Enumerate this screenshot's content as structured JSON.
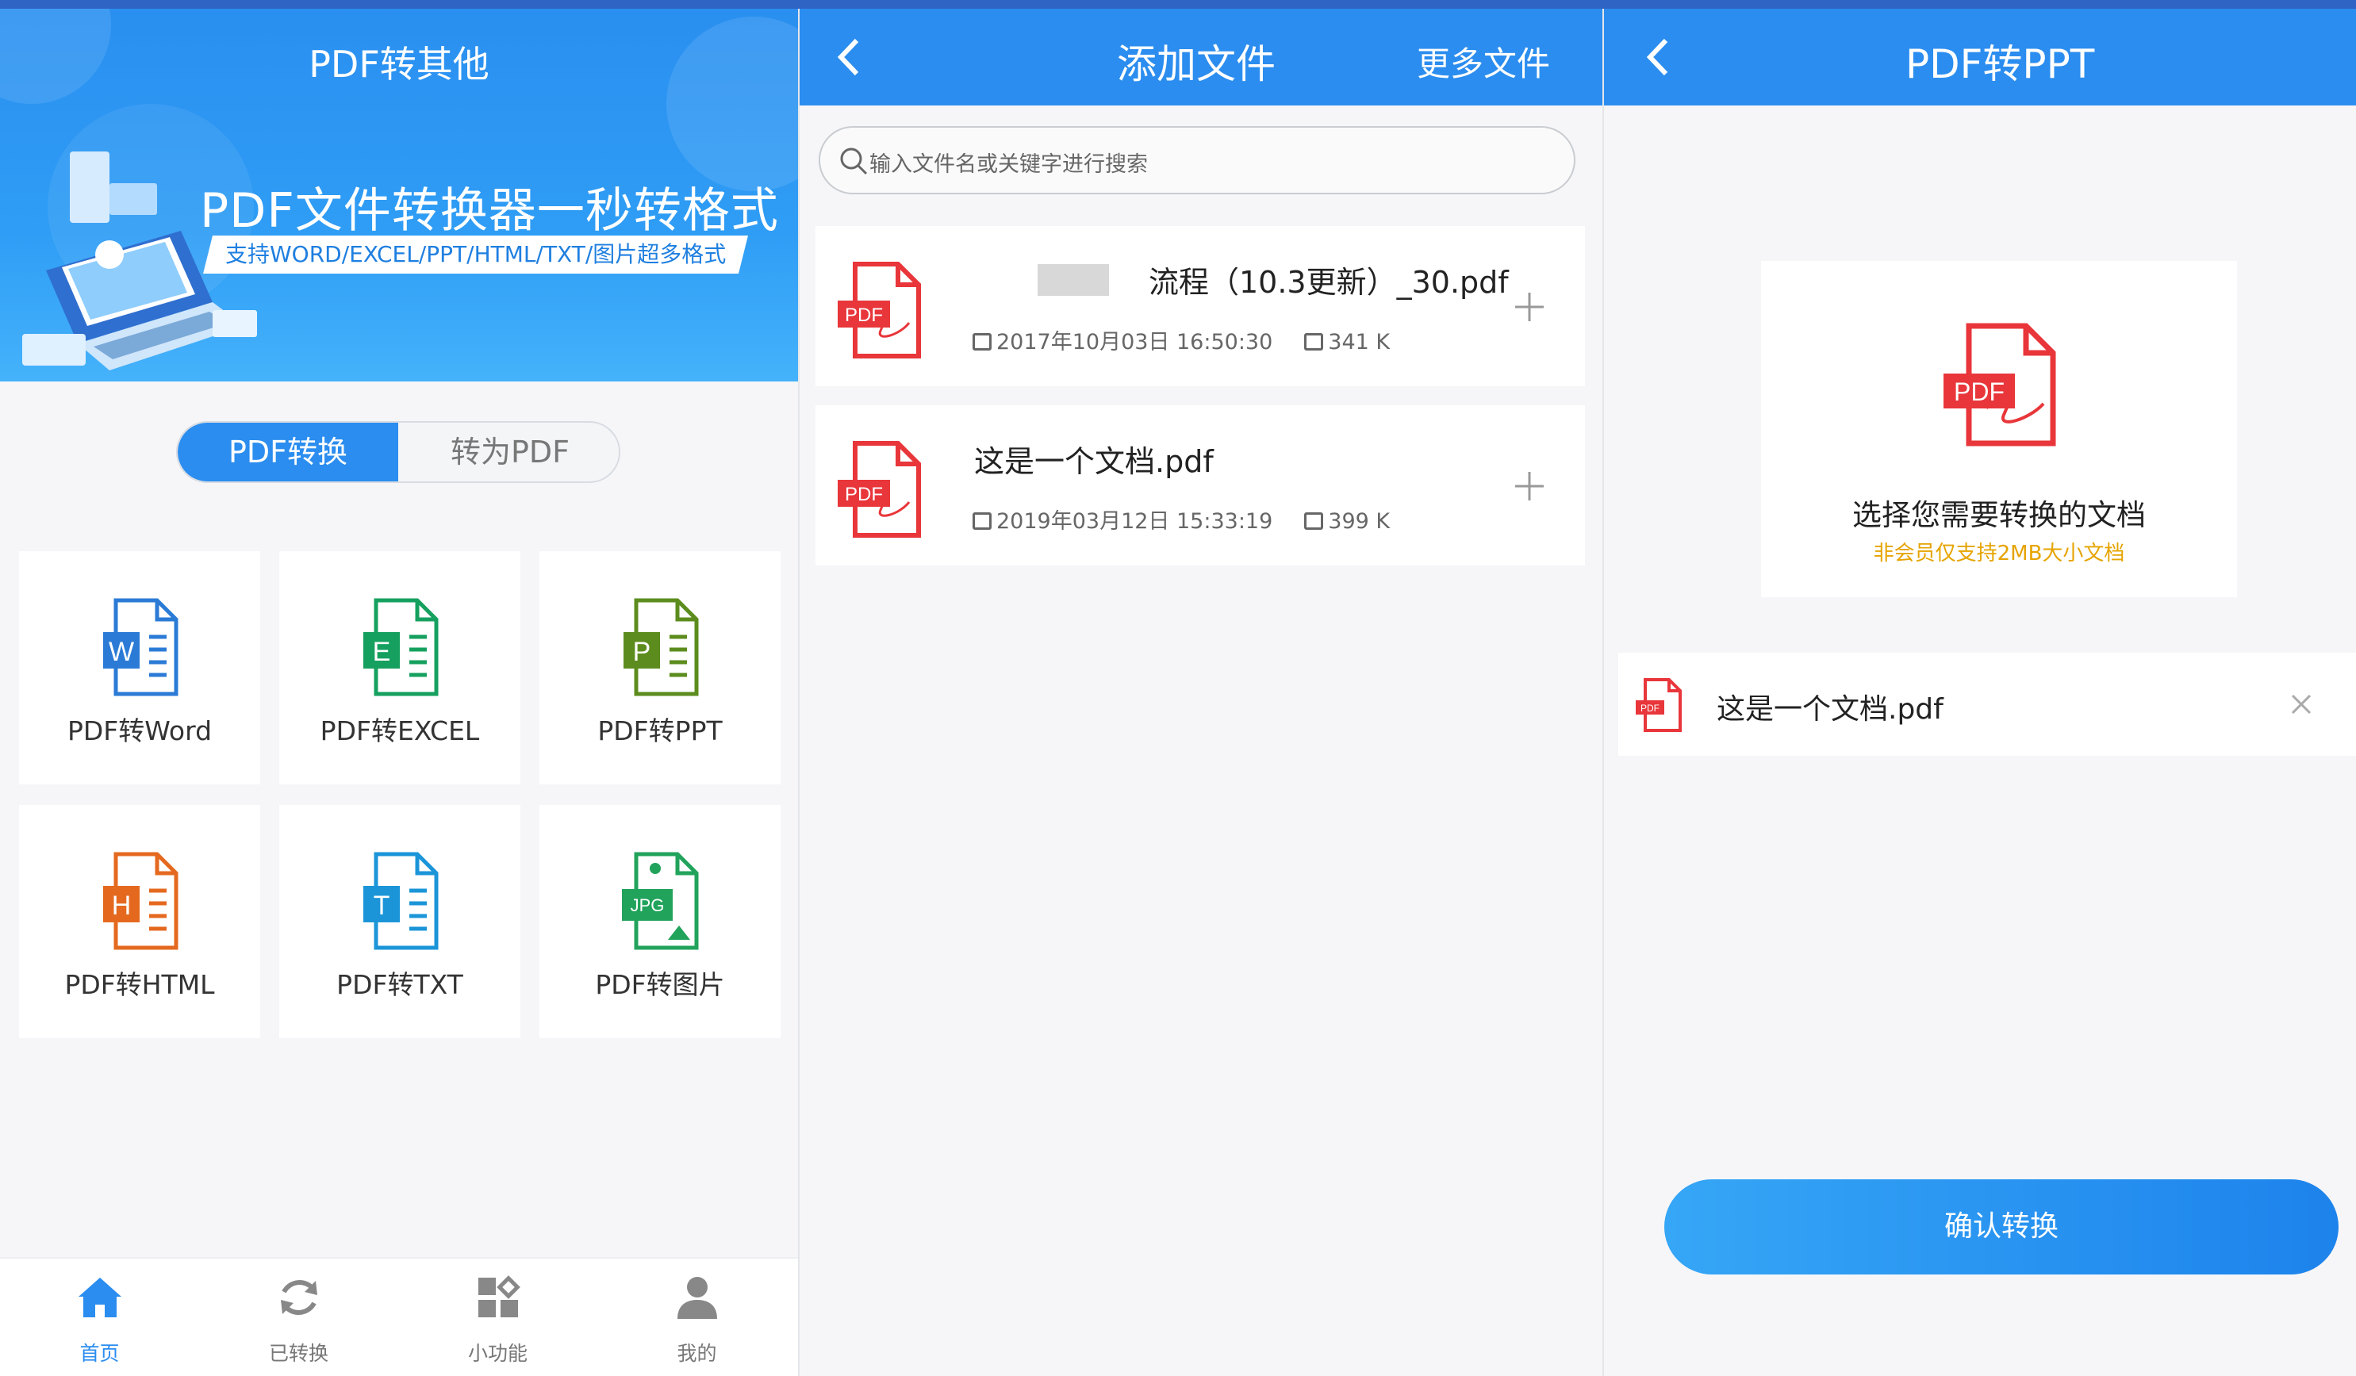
{
  "colors": {
    "accent": "#2b8def",
    "pdf_red": "#e8363a",
    "word_blue": "#2b7bd6",
    "excel_green": "#16a05f",
    "ppt_green": "#5c8c1e",
    "html_orange": "#e4691f",
    "txt_blue": "#1b95d8",
    "jpg_green": "#21a35b",
    "warn": "#e6a400"
  },
  "panel1": {
    "title": "PDF转其他",
    "banner": {
      "headline": "PDF文件转换器一秒转格式",
      "ribbon": "支持WORD/EXCEL/PPT/HTML/TXT/图片超多格式"
    },
    "segment": {
      "active": "PDF转换",
      "inactive": "转为PDF"
    },
    "tools": [
      {
        "label": "PDF转Word",
        "letter": "W",
        "icon": "word-doc-icon"
      },
      {
        "label": "PDF转EXCEL",
        "letter": "E",
        "icon": "excel-doc-icon"
      },
      {
        "label": "PDF转PPT",
        "letter": "P",
        "icon": "ppt-doc-icon"
      },
      {
        "label": "PDF转HTML",
        "letter": "H",
        "icon": "html-doc-icon"
      },
      {
        "label": "PDF转TXT",
        "letter": "T",
        "icon": "txt-doc-icon"
      },
      {
        "label": "PDF转图片",
        "letter": "JPG",
        "icon": "image-doc-icon"
      }
    ],
    "tabs": [
      {
        "label": "首页",
        "icon": "home-icon",
        "active": true
      },
      {
        "label": "已转换",
        "icon": "refresh-icon",
        "active": false
      },
      {
        "label": "小功能",
        "icon": "apps-icon",
        "active": false
      },
      {
        "label": "我的",
        "icon": "user-icon",
        "active": false
      }
    ]
  },
  "panel2": {
    "title": "添加文件",
    "more": "更多文件",
    "search_placeholder": "输入文件名或关键字进行搜索",
    "pdf_badge": "PDF",
    "files": [
      {
        "name": "流程（10.3更新）_30.pdf",
        "date": "2017年10月03日 16:50:30",
        "size": "341 K"
      },
      {
        "name": "这是一个文档.pdf",
        "date": "2019年03月12日 15:33:19",
        "size": "399 K"
      }
    ]
  },
  "panel3": {
    "title": "PDF转PPT",
    "select_title": "选择您需要转换的文档",
    "select_note": "非会员仅支持2MB大小文档",
    "pdf_badge": "PDF",
    "selected_file": "这是一个文档.pdf",
    "confirm": "确认转换"
  }
}
